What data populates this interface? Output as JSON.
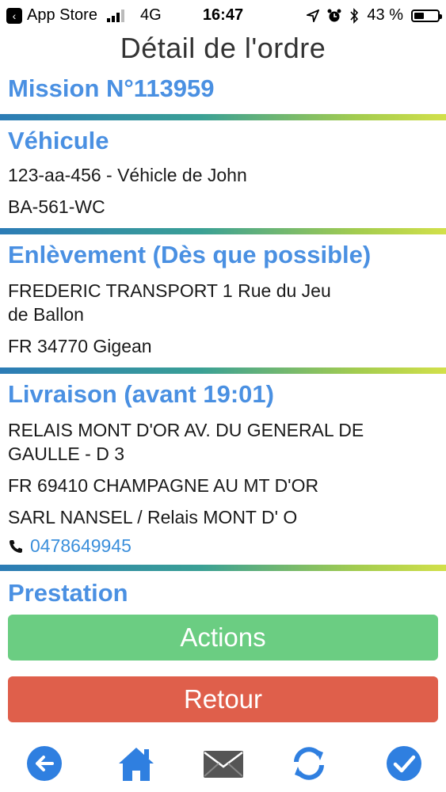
{
  "status_bar": {
    "carrier_back": "App Store",
    "network": "4G",
    "time": "16:47",
    "battery_percent": "43 %",
    "battery_level": 0.43
  },
  "header": {
    "title": "Détail de l'ordre"
  },
  "mission": {
    "title": "Mission N°113959"
  },
  "vehicule": {
    "title": "Véhicule",
    "lines": [
      "123-aa-456 - Véhicle de John",
      "BA-561-WC"
    ]
  },
  "enlevement": {
    "title": "Enlèvement (Dès que possible)",
    "address_line1": "FREDERIC TRANSPORT  1 Rue du Jeu",
    "address_line2": "de Ballon",
    "city": "FR 34770 Gigean"
  },
  "livraison": {
    "title": "Livraison (avant 19:01)",
    "address_line1": "RELAIS MONT D'OR  AV. DU GENERAL DE",
    "address_line2": "GAULLE - D 3",
    "city": "FR 69410 CHAMPAGNE AU MT D'OR",
    "company": "SARL NANSEL / Relais MONT D' O",
    "phone": "0478649945"
  },
  "prestation": {
    "title": "Prestation"
  },
  "buttons": {
    "actions": "Actions",
    "retour": "Retour"
  },
  "tabbar": {
    "icons": [
      "back-arrow-icon",
      "home-icon",
      "mail-icon",
      "sync-icon",
      "check-icon"
    ]
  },
  "colors": {
    "accent_blue": "#4a90e2",
    "actions_green": "#6bcd82",
    "retour_red": "#df5f4b",
    "icon_blue": "#2f7fe0"
  }
}
